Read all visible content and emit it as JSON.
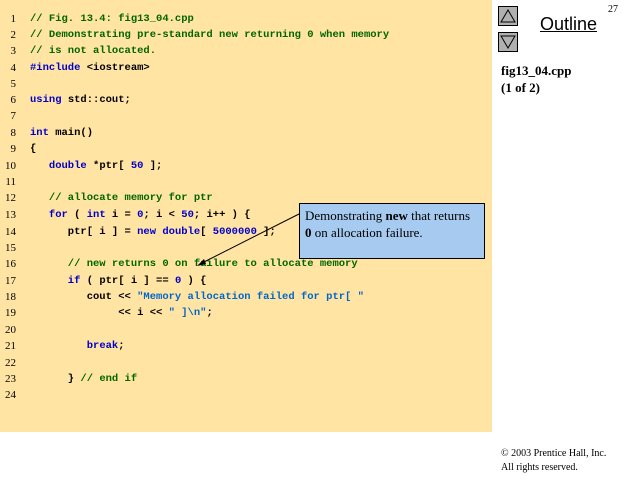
{
  "slide": {
    "page_number": "27",
    "outline_label": "Outline",
    "file_name": "fig13_04.cpp",
    "file_part": "(1 of 2)",
    "copyright": "© 2003 Prentice Hall, Inc.",
    "rights": "All rights reserved."
  },
  "nav": {
    "up_icon": "triangle-up-icon",
    "down_icon": "triangle-down-icon"
  },
  "callout": {
    "t1": "Demonstrating ",
    "b1": "new",
    "t2": " that returns ",
    "b2": "0",
    "t3": " on allocation failure."
  },
  "code": [
    {
      "n": "1"
    },
    {
      "n": "2"
    },
    {
      "n": "3"
    },
    {
      "n": "4"
    },
    {
      "n": "5"
    },
    {
      "n": "6"
    },
    {
      "n": "7"
    },
    {
      "n": "8"
    },
    {
      "n": "9"
    },
    {
      "n": "10"
    },
    {
      "n": "11"
    },
    {
      "n": "12"
    },
    {
      "n": "13"
    },
    {
      "n": "14"
    },
    {
      "n": "15"
    },
    {
      "n": "16"
    },
    {
      "n": "17"
    },
    {
      "n": "18"
    },
    {
      "n": "19"
    },
    {
      "n": "20"
    },
    {
      "n": "21"
    },
    {
      "n": "22"
    },
    {
      "n": "23"
    },
    {
      "n": "24"
    }
  ],
  "tokens": {
    "l1": "// Fig. 13.4: fig13_04.cpp",
    "l2": "// Demonstrating pre-standard new returning 0 when memory",
    "l3": "// is not allocated.",
    "l4a": "#include",
    "l4b": " <iostream>",
    "l6a": "using",
    "l6b": " std::cout;",
    "l8a": "int",
    "l8b": " main()",
    "l9": "{",
    "l10a": "   double",
    "l10b": " *ptr[ ",
    "l10c": "50",
    "l10d": " ];",
    "l12": "   // allocate memory for ptr",
    "l13a": "   for",
    "l13b": " ( ",
    "l13c": "int",
    "l13d": " i = ",
    "l13e": "0",
    "l13f": "; i < ",
    "l13g": "50",
    "l13h": "; i++ ) {",
    "l14a": "      ptr[ i ] = ",
    "l14b": "new",
    "l14c": " ",
    "l14d": "double",
    "l14e": "[ ",
    "l14f": "5000000",
    "l14g": " ];",
    "l16": "      // new returns 0 on failure to allocate memory",
    "l17a": "      if",
    "l17b": " ( ptr[ i ] == ",
    "l17c": "0",
    "l17d": " ) {",
    "l18a": "         cout << ",
    "l18b": "\"Memory allocation failed for ptr[ \"",
    "l19a": "              << i << ",
    "l19b": "\" ]\\n\"",
    "l19c": ";",
    "l21a": "         ",
    "l21b": "break",
    "l21c": ";",
    "l23a": "      } ",
    "l23b": "// end if"
  }
}
